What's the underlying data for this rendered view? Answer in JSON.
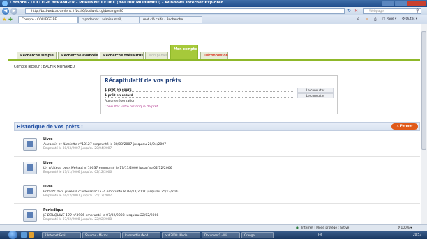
{
  "window": {
    "title": "Compte - COLLEGE BERANGER - PERONNE CEDEX (BACHIR MOHAMED) - Windows Internet Explorer"
  },
  "address": {
    "url": "http://bcdiweb.ac-amiens.fr/bcdi6/bcdiweb.cgi/beranger80",
    "search_placeholder": "Webpage"
  },
  "browser_tabs": [
    {
      "label": "Compte - COLLEGE BE..."
    },
    {
      "label": "tapode.net : admise mail, ..."
    },
    {
      "label": "mot clé calfe - Recherche..."
    }
  ],
  "toolbar": {
    "page_label": "Page",
    "tools_label": "Outils"
  },
  "app_tabs": [
    {
      "label": "Recherche simple"
    },
    {
      "label": "Recherche avancée"
    },
    {
      "label": "Recherche thésaurus"
    },
    {
      "label": "Mon panier"
    },
    {
      "label": "Mon compte"
    },
    {
      "label": "Déconnexion"
    }
  ],
  "account": {
    "label": "Compte lecteur : BACHIR MOHAMED"
  },
  "summary": {
    "title": "Récapitulatif de vos prêts",
    "current": "1 prêt en cours",
    "late": "1 prêt en retard",
    "reservation": "Aucune réservation",
    "history_link": "Consulter votre historique de prêt",
    "consult_label": "Le consulter"
  },
  "history": {
    "title": "Historique de vos prêts :",
    "close_label": "Fermer",
    "items": [
      {
        "type": "Livre",
        "title": "Aucassin et Nicolette",
        "line": " n°10127 emprunté le 30/03/2007 jusqu'au 20/04/2007",
        "returned": "Emprunté le 30/03/2007 jusqu'au 20/04/2007"
      },
      {
        "type": "Livre",
        "title": "Un château pour Mehaut",
        "line": " n°10037 emprunté le 17/11/2006 jusqu'au 02/12/2006",
        "returned": "Emprunté le 17/11/2006 jusqu'au 02/12/2006"
      },
      {
        "type": "Livre",
        "title": "Enfants d'ici, parents d'ailleurs",
        "line": " n°1534 emprunté le 04/12/2007 jusqu'au 25/12/2007",
        "returned": "Emprunté le 04/12/2007 jusqu'au 25/12/2007"
      },
      {
        "type": "Périodique",
        "title": "JE BOUQUINE 100",
        "line": " n°3906 emprunté le 07/02/2008 jusqu'au 22/02/2008",
        "returned": "Emprunté le 07/02/2008 jusqu'au 22/02/2008"
      }
    ]
  },
  "status": {
    "zone": "Internet | Mode protégé : activé",
    "zoom": "100%"
  },
  "taskbar": {
    "items": [
      {
        "label": "2 Internet Expl..."
      },
      {
        "label": "Sources - Micros..."
      },
      {
        "label": "Internetfile (Mod..."
      },
      {
        "label": "bcdi2008 (Mode ..."
      },
      {
        "label": "Document1 - Mi..."
      },
      {
        "label": "Orange"
      }
    ],
    "lang": "FR",
    "clock": "20:53"
  },
  "colors": {
    "accent_green": "#a6c93a",
    "title_blue": "#1f3f7a",
    "close_orange": "#e05a1a"
  }
}
